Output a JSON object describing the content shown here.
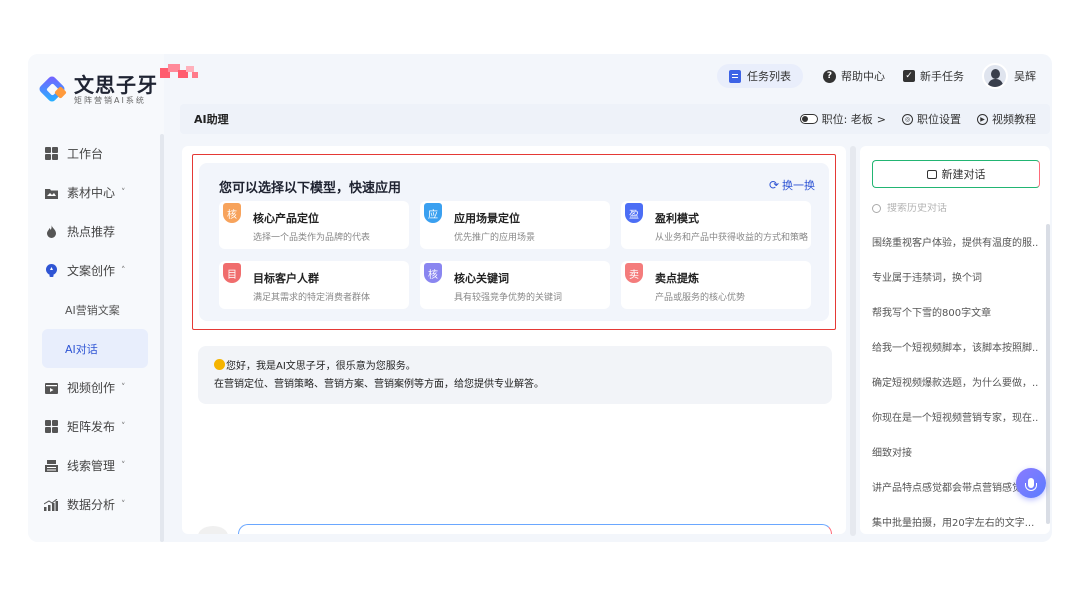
{
  "app": {
    "logo_title": "文思子牙",
    "logo_subtitle": "矩阵营销AI系统"
  },
  "topbar": {
    "task_list": "任务列表",
    "help_center": "帮助中心",
    "newbie_task": "新手任务",
    "user_name": "吴辉"
  },
  "sidebar": {
    "items": [
      {
        "label": "工作台",
        "icon": "dashboard-icon"
      },
      {
        "label": "素材中心",
        "icon": "folder-icon",
        "chevron": "˅"
      },
      {
        "label": "热点推荐",
        "icon": "flame-icon"
      },
      {
        "label": "文案创作",
        "icon": "bulb-icon",
        "chevron": "˄"
      },
      {
        "label": "视频创作",
        "icon": "video-icon",
        "chevron": "˅"
      },
      {
        "label": "矩阵发布",
        "icon": "grid-icon",
        "chevron": "˅"
      },
      {
        "label": "线索管理",
        "icon": "leads-icon",
        "chevron": "˅"
      },
      {
        "label": "数据分析",
        "icon": "chart-icon",
        "chevron": "˅"
      }
    ],
    "sub_items": [
      {
        "label": "AI营销文案"
      },
      {
        "label": "AI对话",
        "active": true
      }
    ]
  },
  "titlebar": {
    "title": "AI助理",
    "position_label": "职位: 老板",
    "position_chevron": ">",
    "position_settings": "职位设置",
    "video_tutorial": "视频教程"
  },
  "models": {
    "heading": "您可以选择以下模型，快速应用",
    "swap": "换一换",
    "cards": [
      {
        "badge": "核",
        "title": "核心产品定位",
        "desc": "选择一个品类作为品牌的代表",
        "color": "#f7a35c"
      },
      {
        "badge": "应",
        "title": "应用场景定位",
        "desc": "优先推广的应用场景",
        "color": "#3aa0f0"
      },
      {
        "badge": "盈",
        "title": "盈利模式",
        "desc": "从业务和产品中获得收益的方式和策略",
        "color": "#4c6ef5"
      },
      {
        "badge": "目",
        "title": "目标客户人群",
        "desc": "满足其需求的特定消费者群体",
        "color": "#f06d6d"
      },
      {
        "badge": "核",
        "title": "核心关键词",
        "desc": "具有较强竞争优势的关键词",
        "color": "#8a86f0"
      },
      {
        "badge": "卖",
        "title": "卖点提炼",
        "desc": "产品或服务的核心优势",
        "color": "#f47c7c"
      }
    ]
  },
  "welcome": {
    "line1": "您好，我是AI文思子牙，很乐意为您服务。",
    "line2": "在营销定位、营销策略、营销方案、营销案例等方面，给您提供专业解答。"
  },
  "history": {
    "new_chat": "新建对话",
    "search_placeholder": "搜索历史对话",
    "items": [
      "围绕重视客户体验，提供有温度的服...",
      "专业属于违禁词，换个词",
      "帮我写个下雪的800字文章",
      "给我一个短视频脚本，该脚本按照脚...",
      "确定短视频爆款选题，为什么要做，...",
      "你现在是一个短视频营销专家，现在...",
      "细致对接",
      "讲产品特点感觉都会带点营销感觉",
      "集中批量拍摄，用20字左右的文字..."
    ]
  }
}
